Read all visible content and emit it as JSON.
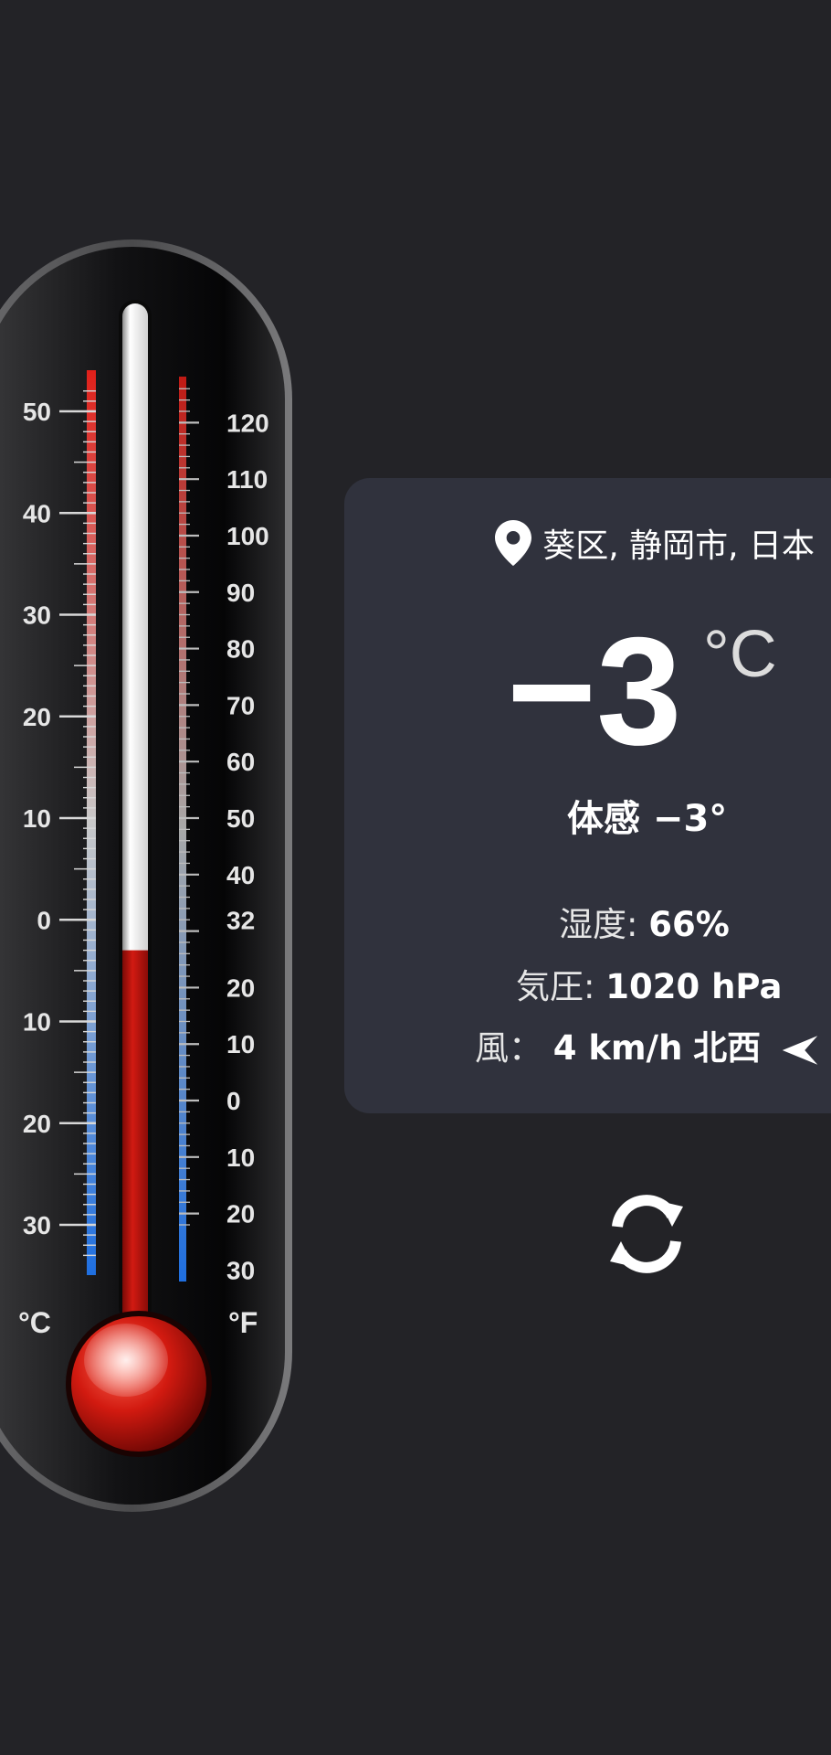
{
  "thermometer": {
    "celsius_unit": "°C",
    "fahrenheit_unit": "°F",
    "celsius_labels": [
      "50",
      "40",
      "30",
      "20",
      "10",
      "0",
      "10",
      "20",
      "30"
    ],
    "fahrenheit_labels": [
      "120",
      "110",
      "100",
      "90",
      "80",
      "70",
      "60",
      "50",
      "40",
      "32",
      "20",
      "10",
      "0",
      "10",
      "20",
      "30"
    ],
    "current_celsius": -3,
    "mercury_color": "#c8150f",
    "bulb_color": "#d61a10"
  },
  "weather": {
    "location": "葵区, 静岡市, 日本",
    "location_icon": "map-pin-icon",
    "temperature": "−3",
    "temperature_unit": "°C",
    "feels_like": "体感 −3°",
    "humidity_label": "湿度:",
    "humidity_value": "66%",
    "pressure_label": "気圧:",
    "pressure_value": "1020 hPa",
    "wind_label": "風：",
    "wind_value": "4 km/h",
    "wind_direction": "北西",
    "wind_icon": "navigation-arrow-icon"
  },
  "actions": {
    "refresh_icon": "refresh-icon"
  },
  "colors": {
    "background": "#232327",
    "card": "#30323d",
    "accent_red": "#c8150f"
  }
}
